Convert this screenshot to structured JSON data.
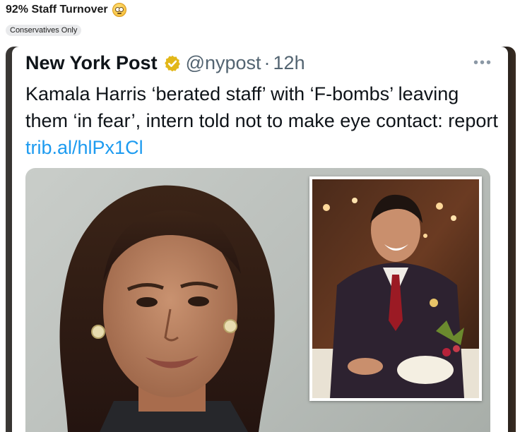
{
  "post": {
    "title": "92% Staff Turnover",
    "emoji_icon": "rolling-eyes-emoji-icon",
    "flair": "Conservatives Only"
  },
  "tweet": {
    "display_name": "New York Post",
    "verified_icon": "gold-verified-badge-icon",
    "handle": "@nypost",
    "separator": "·",
    "time": "12h",
    "more_icon": "more-options-icon",
    "more_label": "•••",
    "text": "Kamala Harris ‘berated staff’ with ‘F-bombs’ leaving them ‘in fear’, intern told not to make eye contact: report ",
    "link": "trib.al/hlPx1Cl"
  },
  "colors": {
    "link": "#1d9bf0",
    "secondary_text": "#536471",
    "verified_gold": "#e2b719"
  }
}
